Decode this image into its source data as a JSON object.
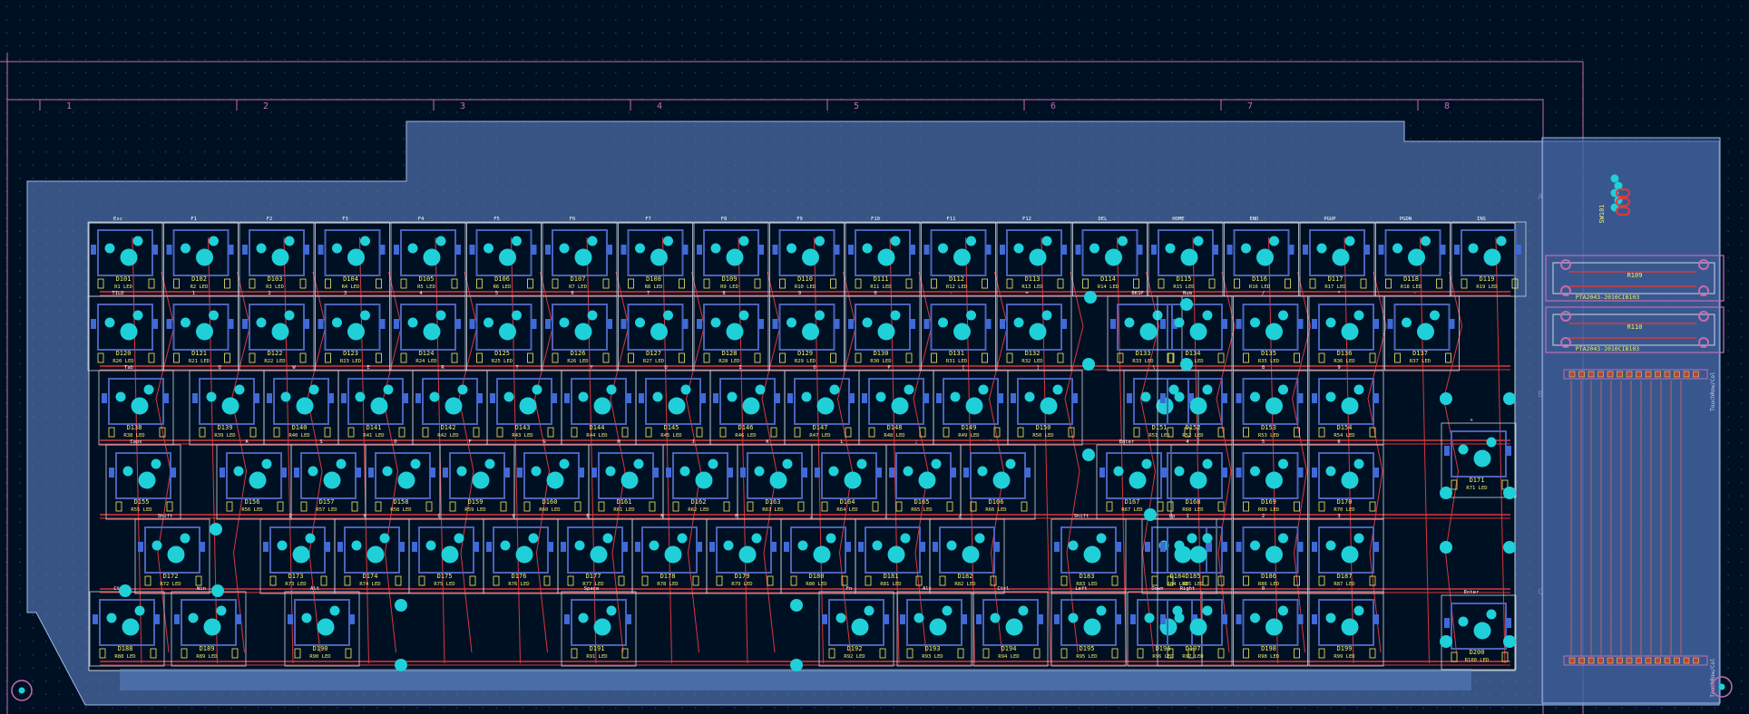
{
  "app": {
    "view": "PCB layout — keyboard"
  },
  "colors": {
    "background": "#001023",
    "grid_dot": "#34445a",
    "frame": "#c46db0",
    "board_fill": "#5b82c4",
    "board_edge": "#9fb7e6",
    "key_frame": "#c8d2de",
    "pad": "#1fd0d8",
    "track": "#d8383e",
    "silk": "#f2ee63",
    "smd": "#b5453d"
  },
  "ruler": {
    "columns": [
      "1",
      "2",
      "3",
      "4",
      "5",
      "6",
      "7",
      "8"
    ],
    "rows": [
      "A",
      "B",
      "C"
    ]
  },
  "rows": [
    {
      "row": 1,
      "keys": [
        {
          "cap": "Esc",
          "ref": "D101",
          "led": "R1 LED"
        },
        {
          "cap": "F1",
          "ref": "D102",
          "led": "R2 LED"
        },
        {
          "cap": "F2",
          "ref": "D103",
          "led": "R3 LED"
        },
        {
          "cap": "F3",
          "ref": "D104",
          "led": "R4 LED"
        },
        {
          "cap": "F4",
          "ref": "D105",
          "led": "R5 LED"
        },
        {
          "cap": "F5",
          "ref": "D106",
          "led": "R6 LED"
        },
        {
          "cap": "F6",
          "ref": "D107",
          "led": "R7 LED"
        },
        {
          "cap": "F7",
          "ref": "D108",
          "led": "R8 LED"
        },
        {
          "cap": "F8",
          "ref": "D109",
          "led": "R9 LED"
        },
        {
          "cap": "F9",
          "ref": "D110",
          "led": "R10 LED"
        },
        {
          "cap": "F10",
          "ref": "D111",
          "led": "R11 LED"
        },
        {
          "cap": "F11",
          "ref": "D112",
          "led": "R12 LED"
        },
        {
          "cap": "F12",
          "ref": "D113",
          "led": "R13 LED"
        },
        {
          "cap": "DEL",
          "ref": "D114",
          "led": "R14 LED"
        },
        {
          "cap": "HOME",
          "ref": "D115",
          "led": "R15 LED"
        },
        {
          "cap": "END",
          "ref": "D116",
          "led": "R16 LED"
        },
        {
          "cap": "PGUP",
          "ref": "D117",
          "led": "R17 LED"
        },
        {
          "cap": "PGDN",
          "ref": "D118",
          "led": "R18 LED"
        },
        {
          "cap": "INS",
          "ref": "D119",
          "led": "R19 LED"
        }
      ]
    },
    {
      "row": 2,
      "keys": [
        {
          "cap": "TILD",
          "ref": "D120",
          "led": "R20 LED"
        },
        {
          "cap": "1",
          "ref": "D121",
          "led": "R21 LED"
        },
        {
          "cap": "2",
          "ref": "D122",
          "led": "R22 LED"
        },
        {
          "cap": "3",
          "ref": "D123",
          "led": "R23 LED"
        },
        {
          "cap": "4",
          "ref": "D124",
          "led": "R24 LED"
        },
        {
          "cap": "5",
          "ref": "D125",
          "led": "R25 LED"
        },
        {
          "cap": "6",
          "ref": "D126",
          "led": "R26 LED"
        },
        {
          "cap": "7",
          "ref": "D127",
          "led": "R27 LED"
        },
        {
          "cap": "8",
          "ref": "D128",
          "led": "R28 LED"
        },
        {
          "cap": "9",
          "ref": "D129",
          "led": "R29 LED"
        },
        {
          "cap": "0",
          "ref": "D130",
          "led": "R30 LED"
        },
        {
          "cap": "-",
          "ref": "D131",
          "led": "R31 LED"
        },
        {
          "cap": "=",
          "ref": "D132",
          "led": "R32 LED"
        },
        {
          "cap": "BKSP",
          "ref": "D133",
          "led": "R33 LED"
        },
        {
          "cap": "Num",
          "ref": "D134",
          "led": "R34 LED"
        },
        {
          "cap": "/",
          "ref": "D135",
          "led": "R35 LED"
        },
        {
          "cap": "*",
          "ref": "D136",
          "led": "R36 LED"
        },
        {
          "cap": "-",
          "ref": "D137",
          "led": "R37 LED"
        }
      ]
    },
    {
      "row": 3,
      "keys": [
        {
          "cap": "Tab",
          "ref": "D138",
          "led": "R38 LED"
        },
        {
          "cap": "Q",
          "ref": "D139",
          "led": "R39 LED"
        },
        {
          "cap": "W",
          "ref": "D140",
          "led": "R40 LED"
        },
        {
          "cap": "E",
          "ref": "D141",
          "led": "R41 LED"
        },
        {
          "cap": "R",
          "ref": "D142",
          "led": "R42 LED"
        },
        {
          "cap": "T",
          "ref": "D143",
          "led": "R43 LED"
        },
        {
          "cap": "Y",
          "ref": "D144",
          "led": "R44 LED"
        },
        {
          "cap": "U",
          "ref": "D145",
          "led": "R45 LED"
        },
        {
          "cap": "I",
          "ref": "D146",
          "led": "R46 LED"
        },
        {
          "cap": "O",
          "ref": "D147",
          "led": "R47 LED"
        },
        {
          "cap": "P",
          "ref": "D148",
          "led": "R48 LED"
        },
        {
          "cap": "[",
          "ref": "D149",
          "led": "R49 LED"
        },
        {
          "cap": "]",
          "ref": "D150",
          "led": "R50 LED"
        },
        {
          "cap": "\\",
          "ref": "D151",
          "led": "R51 LED"
        },
        {
          "cap": "7",
          "ref": "D152",
          "led": "R52 LED"
        },
        {
          "cap": "8",
          "ref": "D153",
          "led": "R53 LED"
        },
        {
          "cap": "9",
          "ref": "D154",
          "led": "R54 LED"
        },
        {
          "cap": "+",
          "ref": "D171",
          "led": "R71 LED"
        }
      ]
    },
    {
      "row": 4,
      "keys": [
        {
          "cap": "Caps",
          "ref": "D155",
          "led": "R55 LED"
        },
        {
          "cap": "A",
          "ref": "D156",
          "led": "R56 LED"
        },
        {
          "cap": "S",
          "ref": "D157",
          "led": "R57 LED"
        },
        {
          "cap": "D",
          "ref": "D158",
          "led": "R58 LED"
        },
        {
          "cap": "F",
          "ref": "D159",
          "led": "R59 LED"
        },
        {
          "cap": "G",
          "ref": "D160",
          "led": "R60 LED"
        },
        {
          "cap": "H",
          "ref": "D161",
          "led": "R61 LED"
        },
        {
          "cap": "J",
          "ref": "D162",
          "led": "R62 LED"
        },
        {
          "cap": "K",
          "ref": "D163",
          "led": "R63 LED"
        },
        {
          "cap": "L",
          "ref": "D164",
          "led": "R64 LED"
        },
        {
          "cap": ";",
          "ref": "D165",
          "led": "R65 LED"
        },
        {
          "cap": "'",
          "ref": "D166",
          "led": "R66 LED"
        },
        {
          "cap": "Enter",
          "ref": "D167",
          "led": "R67 LED"
        },
        {
          "cap": "4",
          "ref": "D168",
          "led": "R68 LED"
        },
        {
          "cap": "5",
          "ref": "D169",
          "led": "R69 LED"
        },
        {
          "cap": "6",
          "ref": "D170",
          "led": "R70 LED"
        }
      ]
    },
    {
      "row": 5,
      "keys": [
        {
          "cap": "Shift",
          "ref": "D172",
          "led": "R72 LED"
        },
        {
          "cap": "Z",
          "ref": "D173",
          "led": "R73 LED"
        },
        {
          "cap": "X",
          "ref": "D174",
          "led": "R74 LED"
        },
        {
          "cap": "C",
          "ref": "D175",
          "led": "R75 LED"
        },
        {
          "cap": "V",
          "ref": "D176",
          "led": "R76 LED"
        },
        {
          "cap": "B",
          "ref": "D177",
          "led": "R77 LED"
        },
        {
          "cap": "N",
          "ref": "D178",
          "led": "R78 LED"
        },
        {
          "cap": "M",
          "ref": "D179",
          "led": "R79 LED"
        },
        {
          "cap": ",",
          "ref": "D180",
          "led": "R80 LED"
        },
        {
          "cap": ".",
          "ref": "D181",
          "led": "R81 LED"
        },
        {
          "cap": "/",
          "ref": "D182",
          "led": "R82 LED"
        },
        {
          "cap": "Shift",
          "ref": "D183",
          "led": "R83 LED"
        },
        {
          "cap": "Up",
          "ref": "D184",
          "led": "R84 LED"
        },
        {
          "cap": "1",
          "ref": "D185",
          "led": "R85 LED"
        },
        {
          "cap": "2",
          "ref": "D186",
          "led": "R86 LED"
        },
        {
          "cap": "3",
          "ref": "D187",
          "led": "R87 LED"
        },
        {
          "cap": "Enter",
          "ref": "D200",
          "led": "R100 LED"
        }
      ]
    },
    {
      "row": 6,
      "keys": [
        {
          "cap": "Ctrl",
          "ref": "D188",
          "led": "R88 LED"
        },
        {
          "cap": "Win",
          "ref": "D189",
          "led": "R89 LED"
        },
        {
          "cap": "Alt",
          "ref": "D190",
          "led": "R90 LED"
        },
        {
          "cap": "Space",
          "ref": "D191",
          "led": "R91 LED"
        },
        {
          "cap": "Fn",
          "ref": "D192",
          "led": "R92 LED"
        },
        {
          "cap": "Alt",
          "ref": "D193",
          "led": "R93 LED"
        },
        {
          "cap": "Ctrl",
          "ref": "D194",
          "led": "R94 LED"
        },
        {
          "cap": "Left",
          "ref": "D195",
          "led": "R95 LED"
        },
        {
          "cap": "Down",
          "ref": "D196",
          "led": "R96 LED"
        },
        {
          "cap": "Right",
          "ref": "D197",
          "led": "R97 LED"
        },
        {
          "cap": "0",
          "ref": "D198",
          "led": "R98 LED"
        },
        {
          "cap": ".",
          "ref": "D199",
          "led": "R99 LED"
        }
      ]
    }
  ],
  "side_panel": {
    "switch_ref": "SW101",
    "resistors": [
      {
        "ref": "R109",
        "part": "PTA2043-2010CIB103"
      },
      {
        "ref": "R110",
        "part": "PTA2043-2010CIB103"
      }
    ],
    "connector_label_top": "TouchRow/Col",
    "connector_label_bottom": "TouchRow/Col"
  }
}
